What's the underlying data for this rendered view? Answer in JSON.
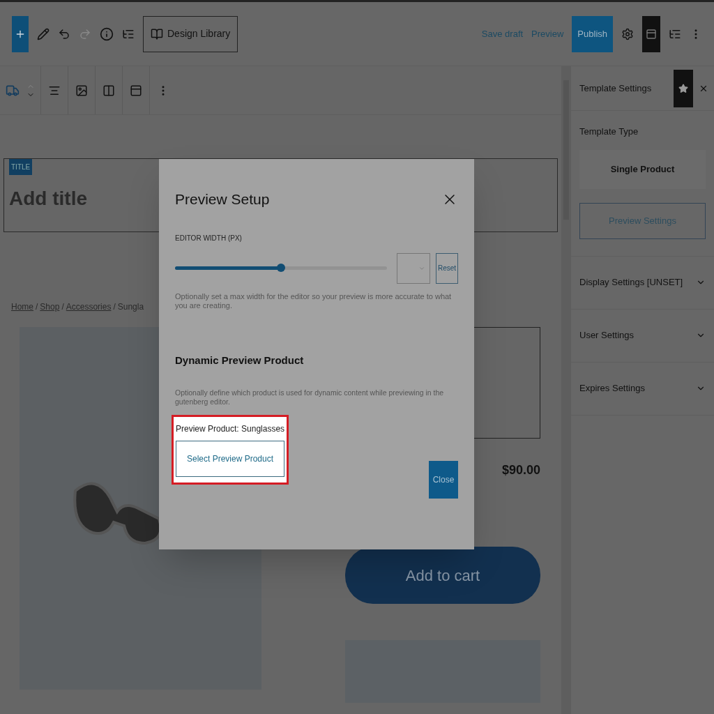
{
  "top_bar": {
    "history": [
      {
        "disabled": false
      },
      {
        "disabled": true
      }
    ],
    "library_button": "Design Library",
    "save_draft": "Save draft",
    "preview": "Preview",
    "publish": "Publish"
  },
  "editor": {
    "title_badge": "TITLE",
    "title_placeholder": "Add title",
    "breadcrumb_separator": "/",
    "breadcrumbs": [
      {
        "label": "Home",
        "link": true
      },
      {
        "label": "Shop",
        "link": true
      },
      {
        "label": "Accessories",
        "link": true
      },
      {
        "label": "Sungla",
        "link": false
      }
    ],
    "price": "$90.00",
    "add_to_cart": "Add to cart"
  },
  "sidebar": {
    "title": "Template Settings",
    "template_type_label": "Template Type",
    "template_type": "Single Product",
    "preview_settings": "Preview Settings",
    "sections": [
      {
        "label": "Display Settings [UNSET]",
        "expanded": false
      },
      {
        "label": "User Settings",
        "expanded": false
      },
      {
        "label": "Expires Settings",
        "expanded": false
      }
    ]
  },
  "modal": {
    "title": "Preview Setup",
    "width_label": "EDITOR WIDTH (PX)",
    "width_slider": {
      "level": 0.5
    },
    "reset": "Reset",
    "width_help": "Optionally set a max width for the editor so your preview is more accurate to what you are creating.",
    "product_heading": "Dynamic Preview Product",
    "product_help": "Optionally define which product is used for dynamic content while previewing in the gutenberg editor.",
    "preview_product": "Preview Product: Sunglasses",
    "select_button": "Select Preview Product",
    "highlighted": true,
    "close": "Close"
  }
}
